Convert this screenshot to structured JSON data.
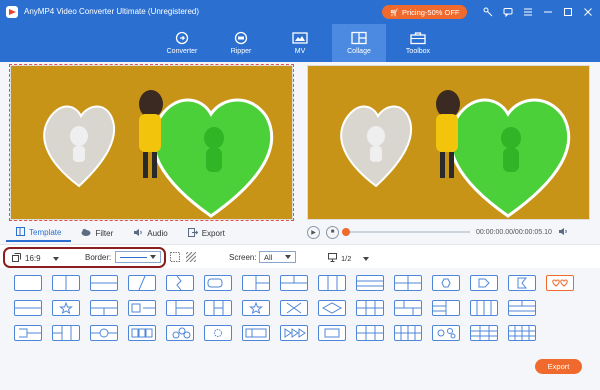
{
  "app": {
    "title": "AnyMP4 Video Converter Ultimate (Unregistered)"
  },
  "titlebar": {
    "pricing_label": "Pricing-50% OFF",
    "icons": [
      "key-icon",
      "chat-icon",
      "menu-icon",
      "minimize-icon",
      "maximize-icon",
      "close-icon"
    ]
  },
  "nav": {
    "items": [
      {
        "label": "Converter",
        "icon": "converter-icon"
      },
      {
        "label": "Ripper",
        "icon": "ripper-icon"
      },
      {
        "label": "MV",
        "icon": "mv-icon"
      },
      {
        "label": "Collage",
        "icon": "collage-icon",
        "active": true
      },
      {
        "label": "Toolbox",
        "icon": "toolbox-icon"
      }
    ]
  },
  "tabs": [
    {
      "label": "Template",
      "icon": "template-icon",
      "active": true
    },
    {
      "label": "Filter",
      "icon": "filter-icon"
    },
    {
      "label": "Audio",
      "icon": "audio-icon"
    },
    {
      "label": "Export",
      "icon": "export-icon"
    }
  ],
  "player": {
    "timecode": "00:00:00.00/00:00:05.10",
    "progress": 0.0
  },
  "options": {
    "ratio": "16:9",
    "border_label": "Border:",
    "screen_label": "Screen:",
    "screen_value": "All",
    "page": "1/2"
  },
  "footer": {
    "export_label": "Export"
  },
  "colors": {
    "accent": "#2b6fd1",
    "orange": "#f06a2d",
    "preview_bg": "#c89417",
    "highlight": "#8b1e1e"
  }
}
